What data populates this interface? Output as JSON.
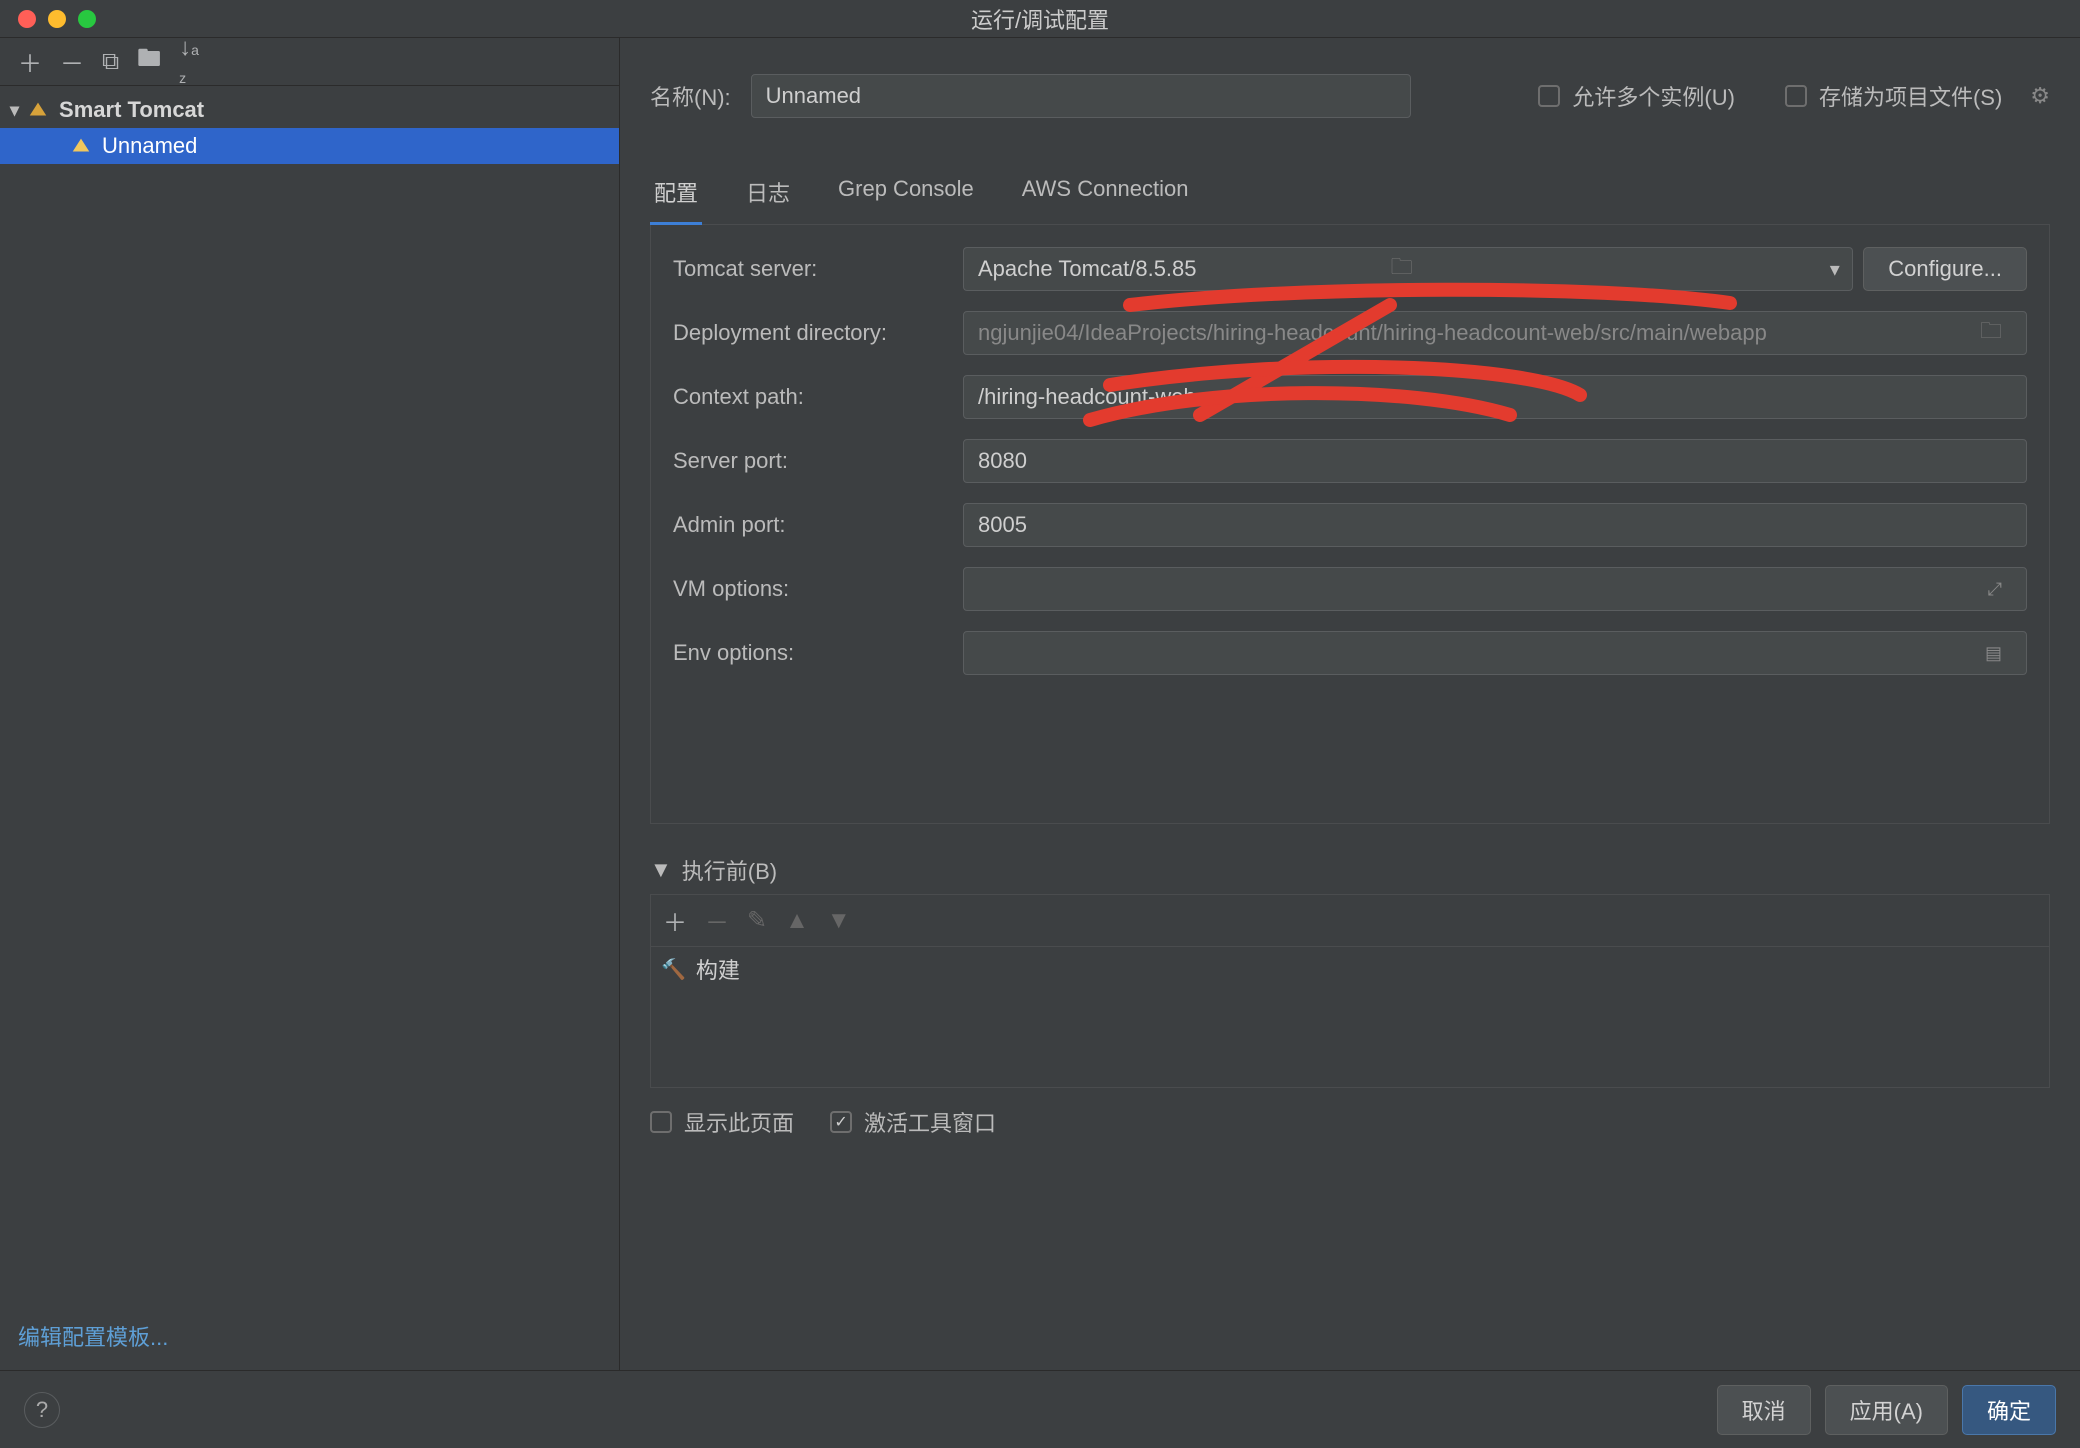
{
  "window": {
    "title": "运行/调试配置"
  },
  "sidebar": {
    "root_label": "Smart Tomcat",
    "items": [
      {
        "label": "Unnamed"
      }
    ],
    "template_link": "编辑配置模板..."
  },
  "header": {
    "name_label": "名称(N):",
    "name_value": "Unnamed",
    "allow_multiple": "允许多个实例(U)",
    "store_as_project_file": "存储为项目文件(S)"
  },
  "tabs": [
    {
      "label": "配置",
      "active": true
    },
    {
      "label": "日志",
      "active": false
    },
    {
      "label": "Grep Console",
      "active": false
    },
    {
      "label": "AWS Connection",
      "active": false
    }
  ],
  "form": {
    "tomcat_server_label": "Tomcat server:",
    "tomcat_server_value": "Apache Tomcat/8.5.85",
    "configure_button": "Configure...",
    "deployment_dir_label": "Deployment directory:",
    "deployment_dir_value": "ngjunjie04/IdeaProjects/hiring-headcount/hiring-headcount-web/src/main/webapp",
    "context_path_label": "Context path:",
    "context_path_value": "/hiring-headcount-web",
    "server_port_label": "Server port:",
    "server_port_value": "8080",
    "admin_port_label": "Admin port:",
    "admin_port_value": "8005",
    "vm_options_label": "VM options:",
    "vm_options_value": "",
    "env_options_label": "Env options:",
    "env_options_value": ""
  },
  "before_launch": {
    "title": "执行前(B)",
    "item": "构建"
  },
  "checks": {
    "show_page": "显示此页面",
    "activate_tool_window": "激活工具窗口"
  },
  "footer": {
    "cancel": "取消",
    "apply": "应用(A)",
    "ok": "确定"
  }
}
